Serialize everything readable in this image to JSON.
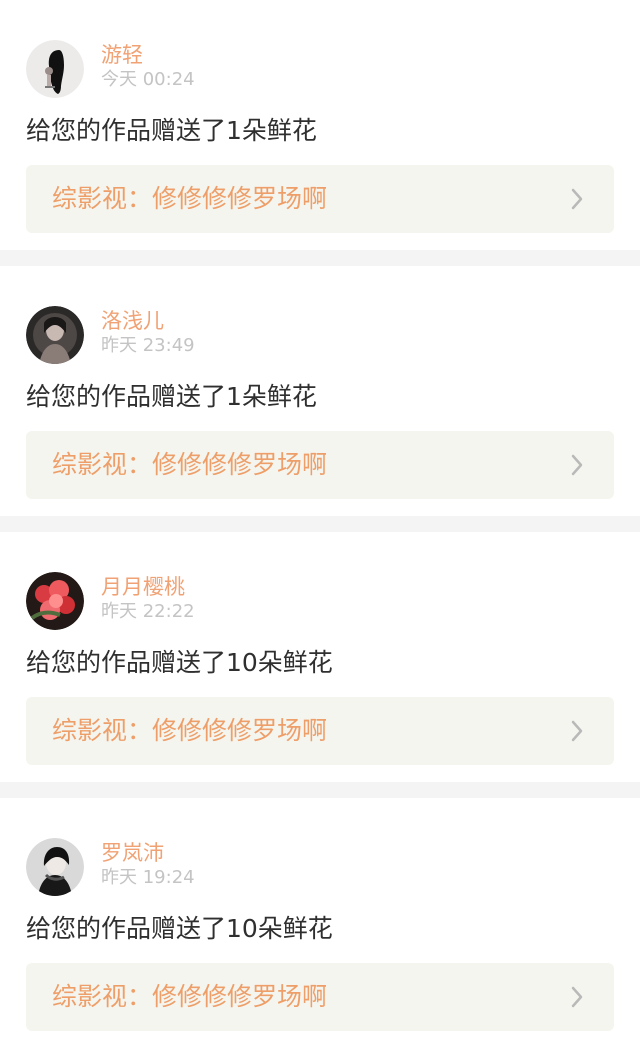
{
  "items": [
    {
      "username": "游轻",
      "time": "今天 00:24",
      "message": "给您的作品赠送了1朵鲜花",
      "work": "综影视：修修修修罗场啊",
      "avatar": "girl-long-hair-avatar"
    },
    {
      "username": "洛浅儿",
      "time": "昨天 23:49",
      "message": "给您的作品赠送了1朵鲜花",
      "work": "综影视：修修修修罗场啊",
      "avatar": "dark-portrait-avatar"
    },
    {
      "username": "月月樱桃",
      "time": "昨天 22:22",
      "message": "给您的作品赠送了10朵鲜花",
      "work": "综影视：修修修修罗场啊",
      "avatar": "red-flowers-avatar"
    },
    {
      "username": "罗岚沛",
      "time": "昨天 19:24",
      "message": "给您的作品赠送了10朵鲜花",
      "work": "综影视：修修修修罗场啊",
      "avatar": "girl-black-white-avatar"
    }
  ],
  "colors": {
    "accent": "#ea8fb1",
    "username": "#f0a274",
    "work_link": "#ee9f69",
    "time": "#c4c4c4",
    "message": "#2f2f2f",
    "card_link_bg": "#f5f5ef",
    "separator": "#f4f4f4"
  },
  "icons": {
    "chevron": "chevron-right-icon"
  }
}
